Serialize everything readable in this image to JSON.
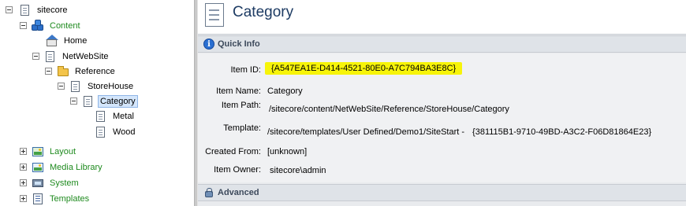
{
  "tree": {
    "root": {
      "label": "sitecore"
    },
    "content": {
      "label": "Content"
    },
    "home": {
      "label": "Home"
    },
    "netwebsite": {
      "label": "NetWebSite"
    },
    "reference": {
      "label": "Reference"
    },
    "storehouse": {
      "label": "StoreHouse"
    },
    "category": {
      "label": "Category"
    },
    "metal": {
      "label": "Metal"
    },
    "wood": {
      "label": "Wood"
    },
    "layout": {
      "label": "Layout"
    },
    "media_library": {
      "label": "Media Library"
    },
    "system": {
      "label": "System"
    },
    "templates": {
      "label": "Templates"
    }
  },
  "header": {
    "title": "Category"
  },
  "quick_info": {
    "title": "Quick Info",
    "item_id_label": "Item ID:",
    "item_id": "{A547EA1E-D414-4521-80E0-A7C794BA3E8C}",
    "item_name_label": "Item Name:",
    "item_name": "Category",
    "item_path_label": "Item Path:",
    "item_path": "/sitecore/content/NetWebSite/Reference/StoreHouse/Category",
    "template_label": "Template:",
    "template_path": "/sitecore/templates/User Defined/Demo1/SiteStart -",
    "template_id": "{381115B1-9710-49BD-A3C2-F06D81864E23}",
    "created_from_label": "Created From:",
    "created_from": "[unknown]",
    "item_owner_label": "Item Owner:",
    "item_owner": "sitecore\\admin"
  },
  "advanced": {
    "title": "Advanced"
  },
  "colors": {
    "highlight": "#f7f409",
    "content_green": "#1e8a1e",
    "selection": "#d4e6fb",
    "title_blue": "#1d3b63"
  }
}
